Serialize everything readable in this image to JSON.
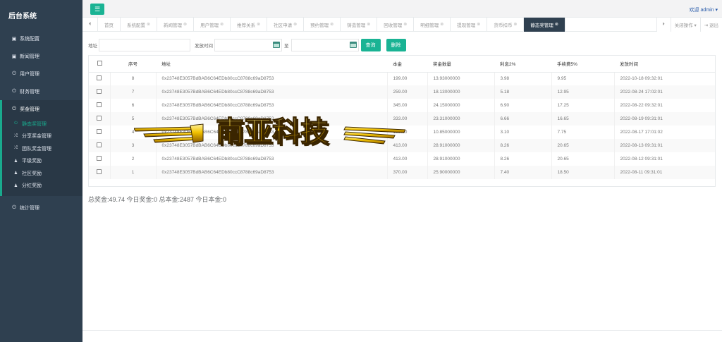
{
  "app": {
    "title": "后台系统"
  },
  "header": {
    "toggle_icon": "menu-icon",
    "welcome": "欢迎 admin ▾"
  },
  "sidebar": {
    "items": [
      {
        "label": "系统配置",
        "icon": "doc-icon",
        "glyph": "▣"
      },
      {
        "label": "新闻管理",
        "icon": "doc-icon",
        "glyph": "▣"
      },
      {
        "label": "用户管理",
        "icon": "power-icon",
        "glyph": "⏻"
      },
      {
        "label": "财务管理",
        "icon": "power-icon",
        "glyph": "⏻"
      }
    ],
    "active_group": {
      "label": "奖金管理",
      "icon": "power-icon",
      "glyph": "⏻"
    },
    "subitems": [
      {
        "label": "静态奖管理",
        "glyph": "⏻",
        "active": true
      },
      {
        "label": "分享奖金管理",
        "glyph": "⤮",
        "active": false
      },
      {
        "label": "团队奖金管理",
        "glyph": "⤮",
        "active": false
      },
      {
        "label": "平级奖励",
        "glyph": "♟",
        "active": false
      },
      {
        "label": "社区奖励",
        "glyph": "♟",
        "active": false
      },
      {
        "label": "分红奖励",
        "glyph": "♟",
        "active": false
      }
    ],
    "last_item": {
      "label": "统计管理",
      "icon": "power-icon",
      "glyph": "⏻"
    }
  },
  "tabs": {
    "left_arrow": "⏴",
    "items": [
      "首页",
      "系统配置",
      "新闻管理",
      "用户管理",
      "推荐关系",
      "社区申请",
      "预约管理",
      "铸造管理",
      "回收管理",
      "明细管理",
      "提现管理",
      "货币扣币",
      "静态奖管理"
    ],
    "active_index": 12,
    "right_arrow": "⏵",
    "close_ops": "关闭操作 ▾",
    "logout": "⇥ 退出"
  },
  "search": {
    "address_label": "地址",
    "time_label": "发放时间",
    "to_label": "至",
    "query_button": "查询",
    "delete_button": "删除"
  },
  "table": {
    "columns": [
      "序号",
      "地址",
      "本金",
      "奖金数量",
      "利息2%",
      "手续费5%",
      "发放时间"
    ],
    "rows": [
      {
        "id": "8",
        "address": "0x23748E3057BdBAB6C64EDb80ccC8788c69aD8753",
        "principal": "199.00",
        "bonus": "13.93000000",
        "interest": "3.98",
        "fee": "9.95",
        "time": "2022-10-18 09:32:01"
      },
      {
        "id": "7",
        "address": "0x23748E3057BdBAB6C64EDb80ccC8788c69aD8753",
        "principal": "259.00",
        "bonus": "18.13000000",
        "interest": "5.18",
        "fee": "12.95",
        "time": "2022-08-24 17:02:01"
      },
      {
        "id": "6",
        "address": "0x23748E3057BdBAB6C64EDb80ccC8788c69aD8753",
        "principal": "345.00",
        "bonus": "24.15000000",
        "interest": "6.90",
        "fee": "17.25",
        "time": "2022-08-22 09:32:01"
      },
      {
        "id": "5",
        "address": "0x23748E3057BdBAB6C64EDb80ccC8788c69aD8753",
        "principal": "333.00",
        "bonus": "23.31000000",
        "interest": "6.66",
        "fee": "16.65",
        "time": "2022-08-19 09:31:01"
      },
      {
        "id": "4",
        "address": "0x23748E3057BdBAB6C64EDb80ccC8788c69aD8753",
        "principal": "155.00",
        "bonus": "10.85000000",
        "interest": "3.10",
        "fee": "7.75",
        "time": "2022-08-17 17:01:02"
      },
      {
        "id": "3",
        "address": "0x23748E3057BdBAB6C64EDb80ccC8788c69aD8753",
        "principal": "413.00",
        "bonus": "28.91000000",
        "interest": "8.26",
        "fee": "20.65",
        "time": "2022-08-13 09:31:01"
      },
      {
        "id": "2",
        "address": "0x23748E3057BdBAB6C64EDb80ccC8788c69aD8753",
        "principal": "413.00",
        "bonus": "28.91000000",
        "interest": "8.26",
        "fee": "20.65",
        "time": "2022-08-12 09:31:01"
      },
      {
        "id": "1",
        "address": "0x23748E3057BdBAB6C64EDb80ccC8788c69aD8753",
        "principal": "370.00",
        "bonus": "25.90000000",
        "interest": "7.40",
        "fee": "18.50",
        "time": "2022-08-11 09:31:01"
      }
    ]
  },
  "totals": "总奖金:49.74  今日奖金:0  总本金:2487  今日本金:0",
  "watermark": {
    "text": "南亚科技",
    "colors": {
      "gold": "#f2c200",
      "dark": "#3a2500"
    }
  }
}
